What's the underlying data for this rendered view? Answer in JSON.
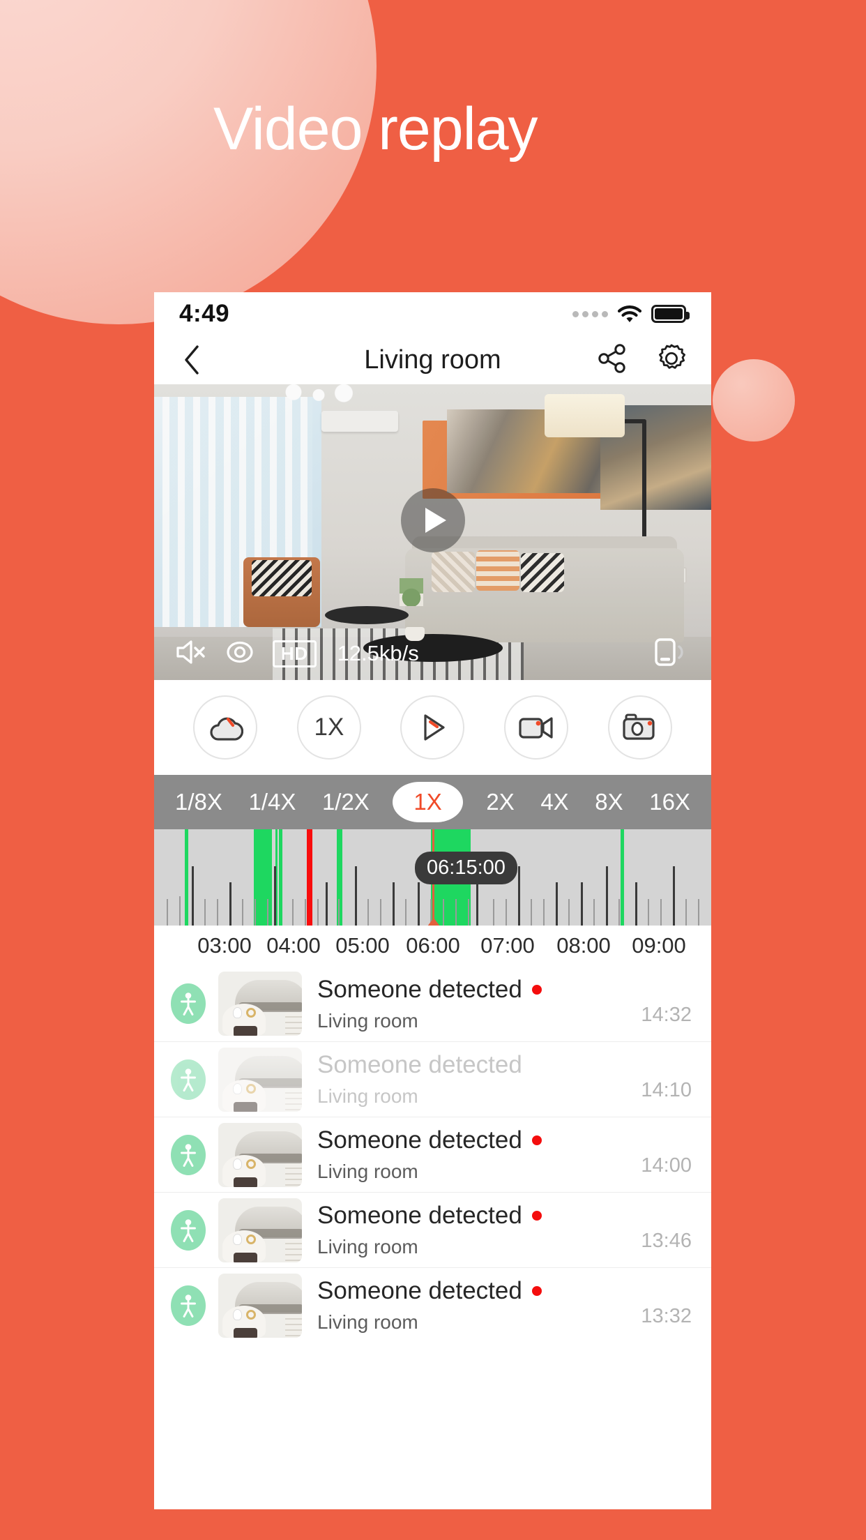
{
  "hero": {
    "title": "Video replay",
    "bg_color": "#ef5f44"
  },
  "phone": {
    "statusbar": {
      "time": "4:49",
      "signal_icon": "signal-dots-icon",
      "wifi_icon": "wifi-icon",
      "battery_icon": "battery-icon"
    },
    "navbar": {
      "back_icon": "chevron-left-icon",
      "title": "Living room",
      "share_icon": "share-icon",
      "settings_icon": "gear-icon"
    },
    "video": {
      "play_icon": "play-icon",
      "mute_icon": "speaker-muted-icon",
      "privacy_icon": "eye-icon",
      "quality_label": "HD",
      "bitrate": "12.5kb/s",
      "fullscreen_icon": "rotate-screen-icon"
    },
    "functions": [
      {
        "name": "cloud-playback-button",
        "icon": "cloud-icon",
        "label": ""
      },
      {
        "name": "speed-button",
        "icon": "",
        "label": "1X"
      },
      {
        "name": "play-direction-button",
        "icon": "play-outline-icon",
        "label": ""
      },
      {
        "name": "record-button",
        "icon": "video-camera-icon",
        "label": ""
      },
      {
        "name": "snapshot-button",
        "icon": "camera-icon",
        "label": ""
      }
    ],
    "speeds": {
      "options": [
        "1/8X",
        "1/4X",
        "1/2X",
        "1X",
        "2X",
        "4X",
        "8X",
        "16X"
      ],
      "selected": "1X",
      "selected_color": "#f04a28",
      "bar_color": "#8b8b8b"
    },
    "timeline": {
      "tooltip": "06:15:00",
      "playhead_time": "06:00",
      "labels": [
        "03:00",
        "04:00",
        "05:00",
        "06:00",
        "07:00",
        "08:00",
        "09:00"
      ],
      "segment_color": "#1ed760",
      "alert_color": "#f80d0d",
      "track_color": "#d4d4d4"
    },
    "events": [
      {
        "type_icon": "person-icon",
        "title": "Someone detected",
        "location": "Living room",
        "time": "14:32",
        "unread": true
      },
      {
        "type_icon": "person-icon",
        "title": "Someone detected",
        "location": "Living room",
        "time": "14:10",
        "unread": false
      },
      {
        "type_icon": "person-icon",
        "title": "Someone detected",
        "location": "Living room",
        "time": "14:00",
        "unread": true
      },
      {
        "type_icon": "person-icon",
        "title": "Someone detected",
        "location": "Living room",
        "time": "13:46",
        "unread": true
      },
      {
        "type_icon": "person-icon",
        "title": "Someone detected",
        "location": "Living room",
        "time": "13:32",
        "unread": true
      }
    ]
  }
}
